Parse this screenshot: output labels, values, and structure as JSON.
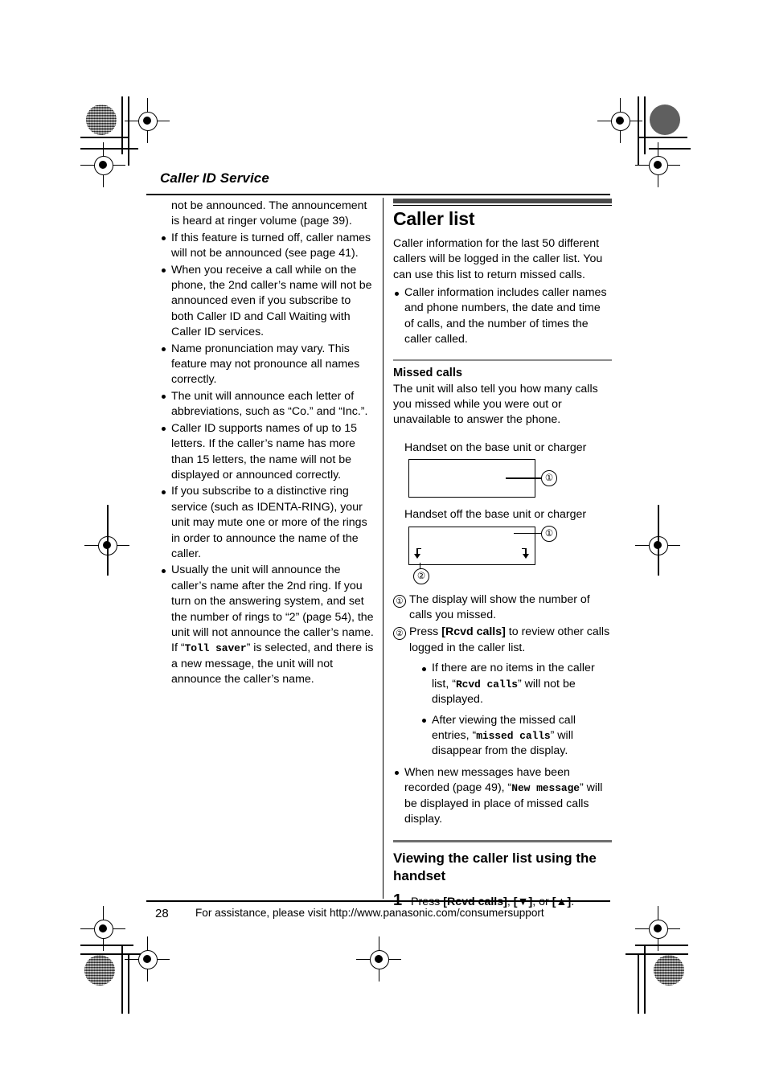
{
  "document": {
    "running_head": "Caller ID Service",
    "page_number": "28",
    "footer_text": "For assistance, please visit http://www.panasonic.com/consumersupport"
  },
  "left_column": {
    "lead_paragraph": "not be announced. The announcement is heard at ringer volume (page 39).",
    "bullets": [
      "If this feature is turned off, caller names will not be announced (see page 41).",
      "When you receive a call while on the phone, the 2nd caller’s name will not be announced even if you subscribe to both Caller ID and Call Waiting with Caller ID services.",
      "Name pronunciation may vary. This feature may not pronounce all names correctly.",
      "The unit will announce each letter of abbreviations, such as “Co.” and “Inc.”.",
      "Caller ID supports names of up to 15 letters. If the caller’s name has more than 15 letters, the name will not be displayed or announced correctly.",
      "If you subscribe to a distinctive ring service (such as IDENTA-RING), your unit may mute one or more of the rings in order to announce the name of the caller."
    ],
    "last_bullet": {
      "part1": "Usually the unit will announce the caller’s name after the 2nd ring. If you turn on the answering system, and set the number of rings to “2” (page 54), the unit will not announce the caller’s name. If “",
      "mono": "Toll saver",
      "part2": "” is selected, and there is a new message, the unit will not announce the caller’s name."
    }
  },
  "right_column": {
    "heading": "Caller list",
    "intro": "Caller information for the last 50 different callers will be logged in the caller list. You can use this list to return missed calls.",
    "intro_bullets": [
      "Caller information includes caller names and phone numbers, the date and time of calls, and the number of times the caller called."
    ],
    "missed_calls": {
      "heading": "Missed calls",
      "body": "The unit will also tell you how many calls you missed while you were out or unavailable to answer the phone.",
      "diagram": {
        "label_on": "Handset on the base unit or charger",
        "label_off": "Handset off the base unit or charger",
        "callout_1": "①",
        "callout_1b": "①",
        "callout_2": "②",
        "lcd_on_content": "",
        "lcd_off_content": ""
      },
      "steps": [
        {
          "marker": "①",
          "text": "The display will show the number of calls you missed."
        },
        {
          "marker": "②",
          "text_before": "Press ",
          "key": "[Rcvd calls]",
          "text_after": " to review other calls logged in the caller list.",
          "sub_bullets": [
            {
              "before": "If there are no items in the caller list, “",
              "mono": "Rcvd calls",
              "after": "” will not be displayed."
            },
            {
              "before": "After viewing the missed call entries, “",
              "mono": "missed calls",
              "after": "” will disappear from the display."
            }
          ]
        }
      ],
      "closing_bullet": {
        "before": "When new messages have been recorded (page 49), “",
        "mono": "New message",
        "after": "” will be displayed in place of missed calls display."
      }
    },
    "viewing_section": {
      "heading": "Viewing the caller list using the handset",
      "step_number": "1",
      "step_prefix": "Press ",
      "step_key1": "[Rcvd calls]",
      "step_sep1": ", ",
      "step_key2": "[▼]",
      "step_sep2": ", or ",
      "step_key3": "[▲]",
      "step_end": "."
    }
  },
  "colors": {
    "heading_bar": "#4a4a4a",
    "section_rule": "#8c8c8c",
    "text": "#000000",
    "background": "#ffffff"
  }
}
